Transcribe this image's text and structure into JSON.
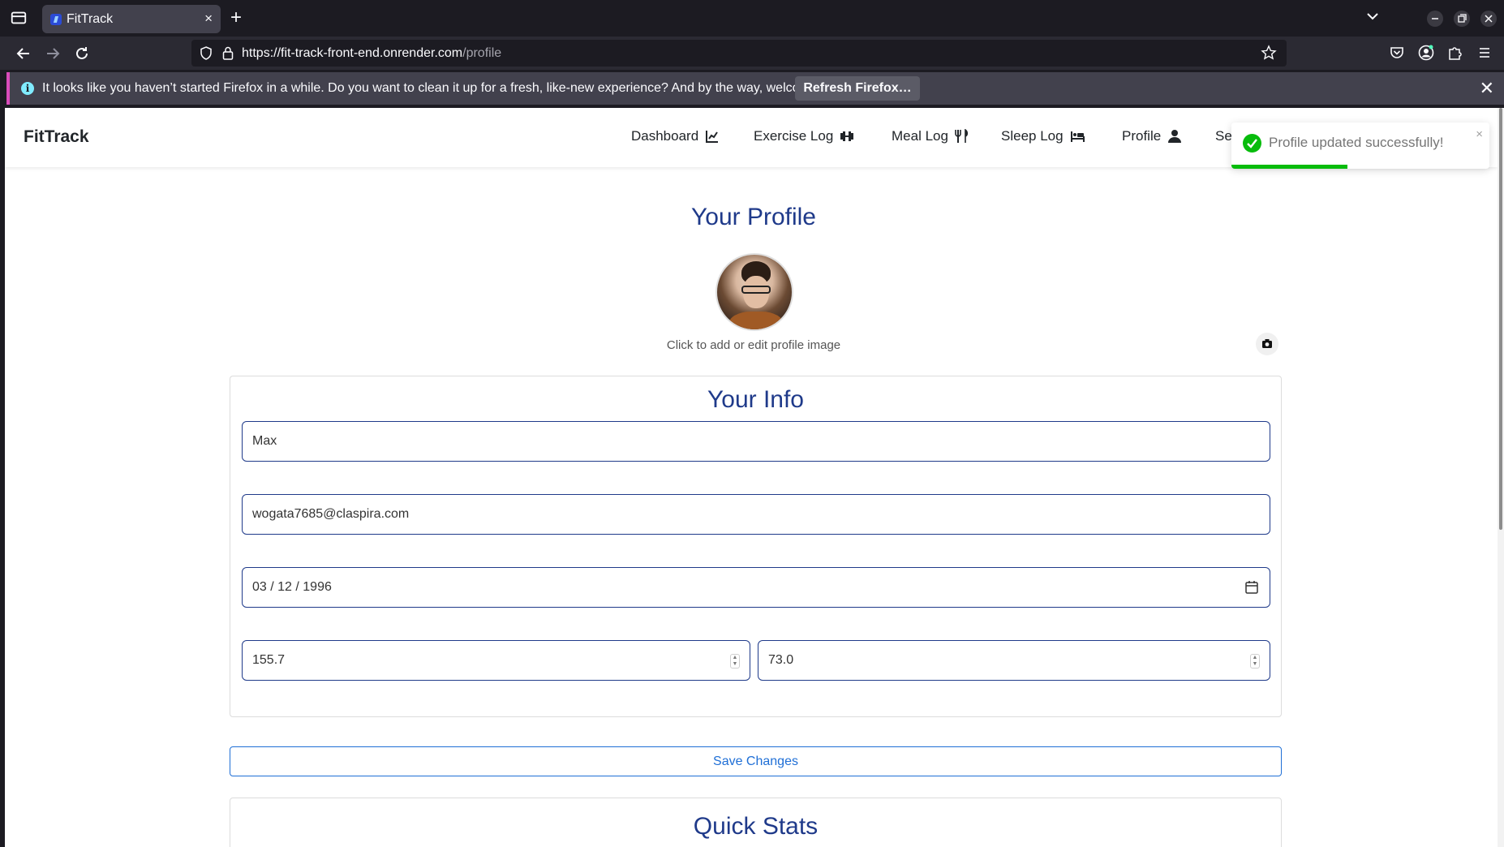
{
  "browser": {
    "tab_title": "FitTrack",
    "tab_close": "×",
    "new_tab": "+",
    "url_host": "https://fit-track-front-end.onrender.com",
    "url_path": "/profile",
    "infobar_message": "It looks like you haven’t started Firefox in a while. Do you want to clean it up for a fresh, like-new experience? And by the way, welcome back!",
    "infobar_button": "Refresh Firefox…",
    "infobar_close": "✕",
    "info_icon": "i"
  },
  "app": {
    "brand": "FitTrack",
    "menu": [
      {
        "label": "Dashboard",
        "icon": "chart-line-icon"
      },
      {
        "label": "Exercise Log",
        "icon": "dumbbell-icon"
      },
      {
        "label": "Meal Log",
        "icon": "utensils-icon"
      },
      {
        "label": "Sleep Log",
        "icon": "bed-icon"
      },
      {
        "label": "Profile",
        "icon": "user-icon"
      },
      {
        "label": "Se",
        "icon": ""
      }
    ]
  },
  "toast": {
    "message": "Profile updated successfully!",
    "close": "×",
    "progress": 0.45,
    "color": "#07bc0c"
  },
  "profile": {
    "title": "Your Profile",
    "avatar_caption": "Click to add or edit profile image",
    "info_title": "Your Info",
    "name": "Max",
    "email": "wogata7685@claspira.com",
    "birthdate": "03 / 12 / 1996",
    "height": "155.7",
    "weight": "73.0",
    "save_label": "Save Changes",
    "stats_title": "Quick Stats"
  },
  "colors": {
    "heading": "#1f3a8a",
    "accent": "#1f6fd6",
    "success": "#07bc0c"
  }
}
